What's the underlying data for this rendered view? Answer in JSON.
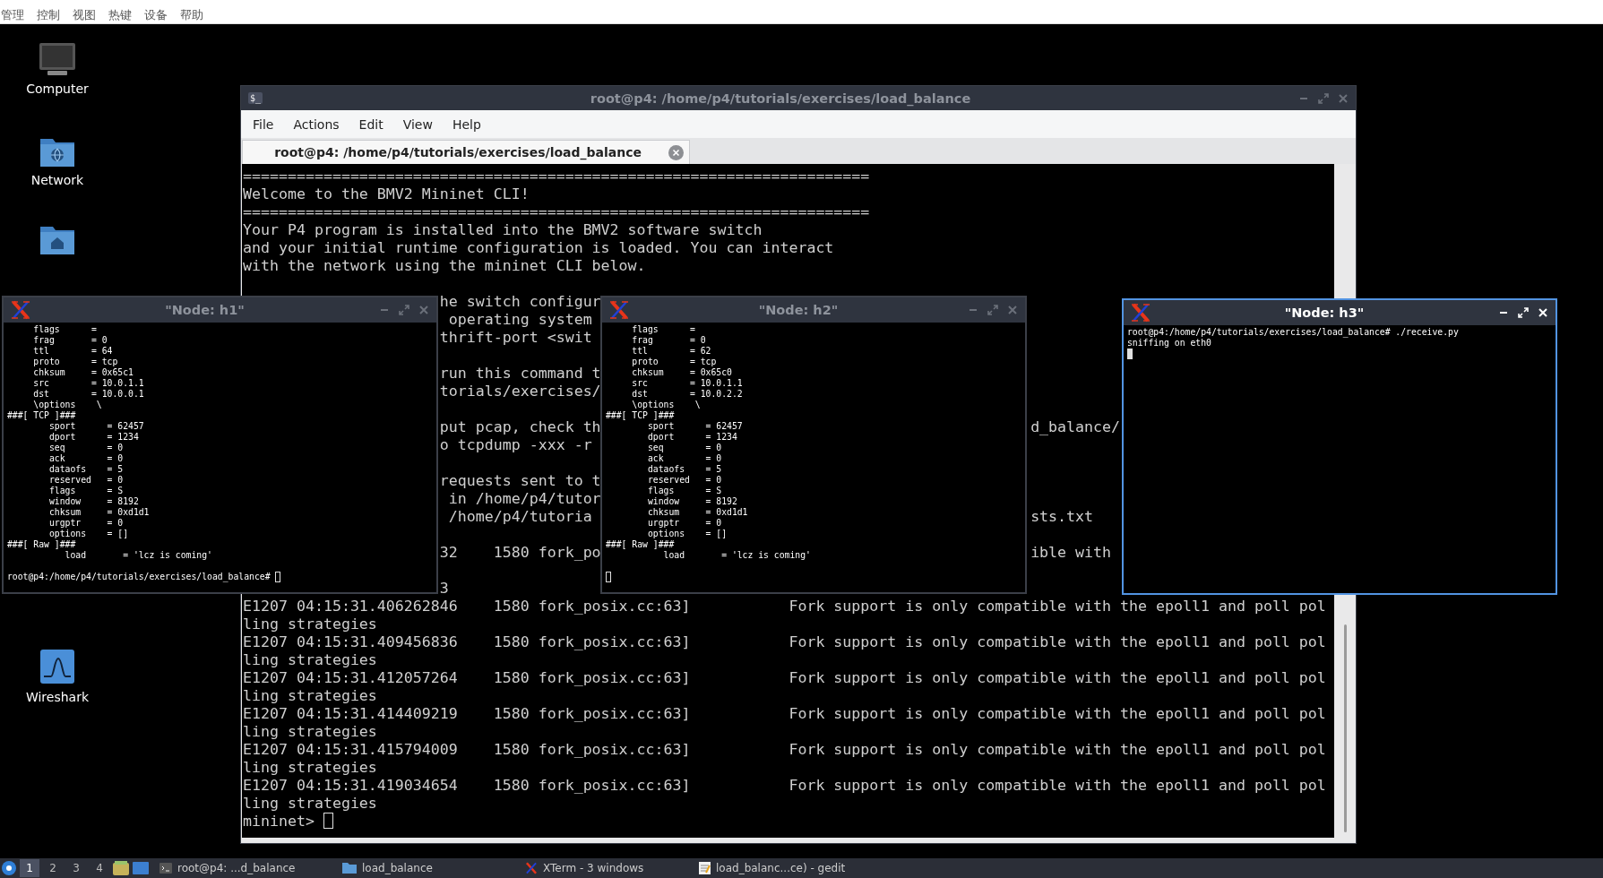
{
  "host_menu": [
    "管理",
    "控制",
    "视图",
    "热键",
    "设备",
    "帮助"
  ],
  "desktop_icons": [
    {
      "kind": "computer",
      "label": "Computer"
    },
    {
      "kind": "network",
      "label": "Network"
    },
    {
      "kind": "home"
    },
    {
      "kind": "wireshark",
      "label": "Wireshark"
    }
  ],
  "main_terminal": {
    "icon_text": "$_",
    "title": "root@p4: /home/p4/tutorials/exercises/load_balance",
    "active": false,
    "menu": [
      "File",
      "Actions",
      "Edit",
      "View",
      "Help"
    ],
    "tabs": [
      {
        "label": "root@p4: /home/p4/tutorials/exercises/load_balance",
        "selected": true
      }
    ],
    "lines": [
      {
        "kind": "full",
        "text": "======================================================================"
      },
      {
        "kind": "full",
        "text": "Welcome to the BMV2 Mininet CLI!"
      },
      {
        "kind": "full",
        "text": "======================================================================"
      },
      {
        "kind": "full",
        "text": "Your P4 program is installed into the BMV2 software switch"
      },
      {
        "kind": "full",
        "text": "and your initial runtime configuration is loaded. You can interact"
      },
      {
        "kind": "full",
        "text": "with the network using the mininet CLI below."
      },
      {
        "kind": "blank"
      },
      {
        "kind": "split",
        "middle": "he switch configur"
      },
      {
        "kind": "split",
        "middle": " operating system"
      },
      {
        "kind": "split",
        "middle": "thrift-port <swit"
      },
      {
        "kind": "blank"
      },
      {
        "kind": "split",
        "middle": "run this command t"
      },
      {
        "kind": "split",
        "middle": "torials/exercises/"
      },
      {
        "kind": "blank"
      },
      {
        "kind": "split",
        "middle": "put pcap, check th",
        "right": "d_balance/"
      },
      {
        "kind": "split",
        "middle": "o tcpdump -xxx -r"
      },
      {
        "kind": "blank"
      },
      {
        "kind": "split",
        "middle": "requests sent to t"
      },
      {
        "kind": "split",
        "middle": " in /home/p4/tutor"
      },
      {
        "kind": "split",
        "middle": " /home/p4/tutoria",
        "right": "sts.txt"
      },
      {
        "kind": "blank"
      },
      {
        "kind": "split",
        "middle": "32    1580 fork_po",
        "right": "ible with"
      },
      {
        "kind": "blank"
      },
      {
        "kind": "split",
        "middle": "3"
      },
      {
        "kind": "full",
        "text": "E1207 04:15:31.406262846    1580 fork_posix.cc:63]           Fork support is only compatible with the epoll1 and poll pol"
      },
      {
        "kind": "full",
        "text": "ling strategies"
      },
      {
        "kind": "full",
        "text": "E1207 04:15:31.409456836    1580 fork_posix.cc:63]           Fork support is only compatible with the epoll1 and poll pol"
      },
      {
        "kind": "full",
        "text": "ling strategies"
      },
      {
        "kind": "full",
        "text": "E1207 04:15:31.412057264    1580 fork_posix.cc:63]           Fork support is only compatible with the epoll1 and poll pol"
      },
      {
        "kind": "full",
        "text": "ling strategies"
      },
      {
        "kind": "full",
        "text": "E1207 04:15:31.414409219    1580 fork_posix.cc:63]           Fork support is only compatible with the epoll1 and poll pol"
      },
      {
        "kind": "full",
        "text": "ling strategies"
      },
      {
        "kind": "full",
        "text": "E1207 04:15:31.415794009    1580 fork_posix.cc:63]           Fork support is only compatible with the epoll1 and poll pol"
      },
      {
        "kind": "full",
        "text": "ling strategies"
      },
      {
        "kind": "full",
        "text": "E1207 04:15:31.419034654    1580 fork_posix.cc:63]           Fork support is only compatible with the epoll1 and poll pol"
      },
      {
        "kind": "full",
        "text": "ling strategies"
      }
    ],
    "prompt": "mininet> "
  },
  "xterms": [
    {
      "title": "\"Node: h1\"",
      "active": false,
      "lines": [
        "     flags      = ",
        "     frag       = 0",
        "     ttl        = 64",
        "     proto      = tcp",
        "     chksum     = 0x65c1",
        "     src        = 10.0.1.1",
        "     dst        = 10.0.0.1",
        "     \\options    \\",
        "###[ TCP ]###",
        "        sport      = 62457",
        "        dport      = 1234",
        "        seq        = 0",
        "        ack        = 0",
        "        dataofs    = 5",
        "        reserved   = 0",
        "        flags      = S",
        "        window     = 8192",
        "        chksum     = 0xd1d1",
        "        urgptr     = 0",
        "        options    = []",
        "###[ Raw ]###",
        "           load       = 'lcz is coming'",
        {
          "kind": "blank"
        }
      ],
      "prompt": "root@p4:/home/p4/tutorials/exercises/load_balance# "
    },
    {
      "title": "\"Node: h2\"",
      "active": false,
      "lines": [
        "     flags      = ",
        "     frag       = 0",
        "     ttl        = 62",
        "     proto      = tcp",
        "     chksum     = 0x65c0",
        "     src        = 10.0.1.1",
        "     dst        = 10.0.2.2",
        "     \\options    \\",
        "###[ TCP ]###",
        "        sport      = 62457",
        "        dport      = 1234",
        "        seq        = 0",
        "        ack        = 0",
        "        dataofs    = 5",
        "        reserved   = 0",
        "        flags      = S",
        "        window     = 8192",
        "        chksum     = 0xd1d1",
        "        urgptr     = 0",
        "        options    = []",
        "###[ Raw ]###",
        "           load       = 'lcz is coming'",
        {
          "kind": "blank"
        }
      ]
    },
    {
      "title": "\"Node: h3\"",
      "active": true,
      "lines": [
        "root@p4:/home/p4/tutorials/exercises/load_balance# ./receive.py",
        "sniffing on eth0"
      ]
    }
  ],
  "taskbar": {
    "workspaces": [
      {
        "label": "1",
        "selected": true
      },
      {
        "label": "2",
        "selected": false
      },
      {
        "label": "3",
        "selected": false
      },
      {
        "label": "4",
        "selected": false
      }
    ],
    "tasks": [
      {
        "kind": "terminal",
        "label": "root@p4: ...d_balance"
      },
      {
        "kind": "folder",
        "label": "load_balance"
      },
      {
        "kind": "xterm",
        "label": "XTerm - 3 windows"
      },
      {
        "kind": "editor",
        "label": "load_balanc...ce) - gedit"
      }
    ]
  }
}
